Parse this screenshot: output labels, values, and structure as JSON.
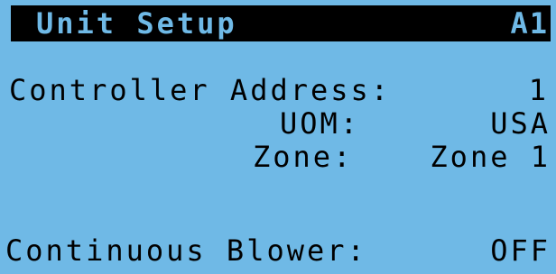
{
  "header": {
    "title": "Unit Setup",
    "screen_code": "A1"
  },
  "settings": {
    "controller_address": {
      "label": "Controller Address:",
      "value": "1"
    },
    "uom": {
      "label": "UOM:",
      "value": "USA"
    },
    "zone": {
      "label": "Zone:",
      "value": "Zone 1"
    },
    "continuous_blower": {
      "label": "Continuous Blower:",
      "value": "OFF"
    }
  },
  "colors": {
    "background": "#6fb9e6",
    "foreground": "#000000"
  }
}
